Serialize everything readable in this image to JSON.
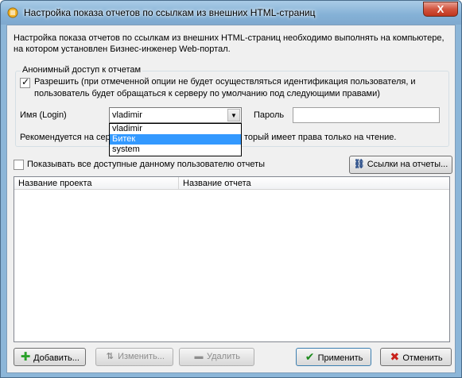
{
  "window": {
    "title": "Настройка показа отчетов по ссылкам из внешних HTML-страниц",
    "close_label": "X"
  },
  "intro": "Настройка показа отчетов по ссылкам из внешних HTML-страниц необходимо выполнять на компьютере, на котором установлен Бизнес-инженер Web-портал.",
  "anon": {
    "legend": "Анонимный доступ к отчетам",
    "allow_checked": true,
    "allow_text": "Разрешить (при отмеченной опции не будет осуществляться идентификация пользователя, и пользователь будет обращаться к серверу по умолчанию под следующими правами)",
    "login_label": "Имя (Login)",
    "login_value": "vladimir",
    "password_label": "Пароль",
    "password_value": "",
    "options": [
      "vladimir",
      "Битек",
      "system"
    ],
    "selected_option": "Битек",
    "recommend_left": "Рекомендуется на сер",
    "recommend_right": "торый имеет права только на чтение."
  },
  "show_all": {
    "checked": false,
    "label": "Показывать все доступные данному пользователю отчеты"
  },
  "links_button": "Ссылки на отчеты...",
  "table": {
    "columns": [
      "Название проекта",
      "Название отчета"
    ],
    "rows": []
  },
  "buttons": {
    "add": "Добавить...",
    "edit": "Изменить...",
    "delete": "Удалить",
    "apply": "Применить",
    "cancel": "Отменить"
  },
  "colors": {
    "selection": "#3399ff",
    "add_icon": "#2aa12a",
    "apply_icon": "#1d8a1d",
    "cancel_icon": "#c8201a"
  }
}
